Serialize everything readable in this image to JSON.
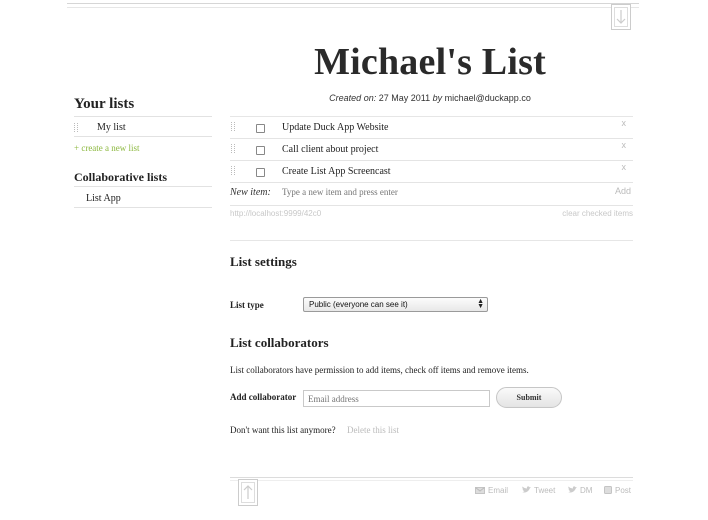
{
  "list": {
    "title": "Michael's List",
    "created_label": "Created on:",
    "created_date": "27 May 2011",
    "by_label": "by",
    "owner_email": "michael@duckapp.co"
  },
  "sidebar": {
    "your_lists_heading": "Your lists",
    "your_lists": [
      {
        "label": "My list"
      }
    ],
    "create_link": "+ create a new list",
    "collab_heading": "Collaborative lists",
    "collab_lists": [
      {
        "label": "List App"
      }
    ]
  },
  "items": [
    {
      "text": "Update Duck App Website",
      "checked": false,
      "remove": "x"
    },
    {
      "text": "Call client about project",
      "checked": false,
      "remove": "x"
    },
    {
      "text": "Create List App Screencast",
      "checked": false,
      "remove": "x"
    }
  ],
  "new_item": {
    "label": "New item:",
    "placeholder": "Type a new item and press enter",
    "add_label": "Add"
  },
  "footer_links": {
    "url": "http://localhost:9999/42c0",
    "clear": "clear checked items"
  },
  "settings": {
    "heading": "List settings",
    "type_label": "List type",
    "type_value": "Public (everyone can see it)"
  },
  "collaborators": {
    "heading": "List collaborators",
    "description": "List collaborators have permission to add items, check off items and remove items.",
    "add_label": "Add collaborator",
    "email_placeholder": "Email address",
    "submit_label": "Submit",
    "delete_prompt": "Don't want this list anymore?",
    "delete_link": "Delete this list"
  },
  "share": {
    "email": "Email",
    "tweet": "Tweet",
    "dm": "DM",
    "post": "Post"
  },
  "colors": {
    "accent_green": "#8cb83f",
    "muted": "#bbbbbb"
  },
  "icons": [
    "arrow-down-icon",
    "arrow-up-icon",
    "grip-icon",
    "email-icon",
    "twitter-icon",
    "post-icon"
  ]
}
